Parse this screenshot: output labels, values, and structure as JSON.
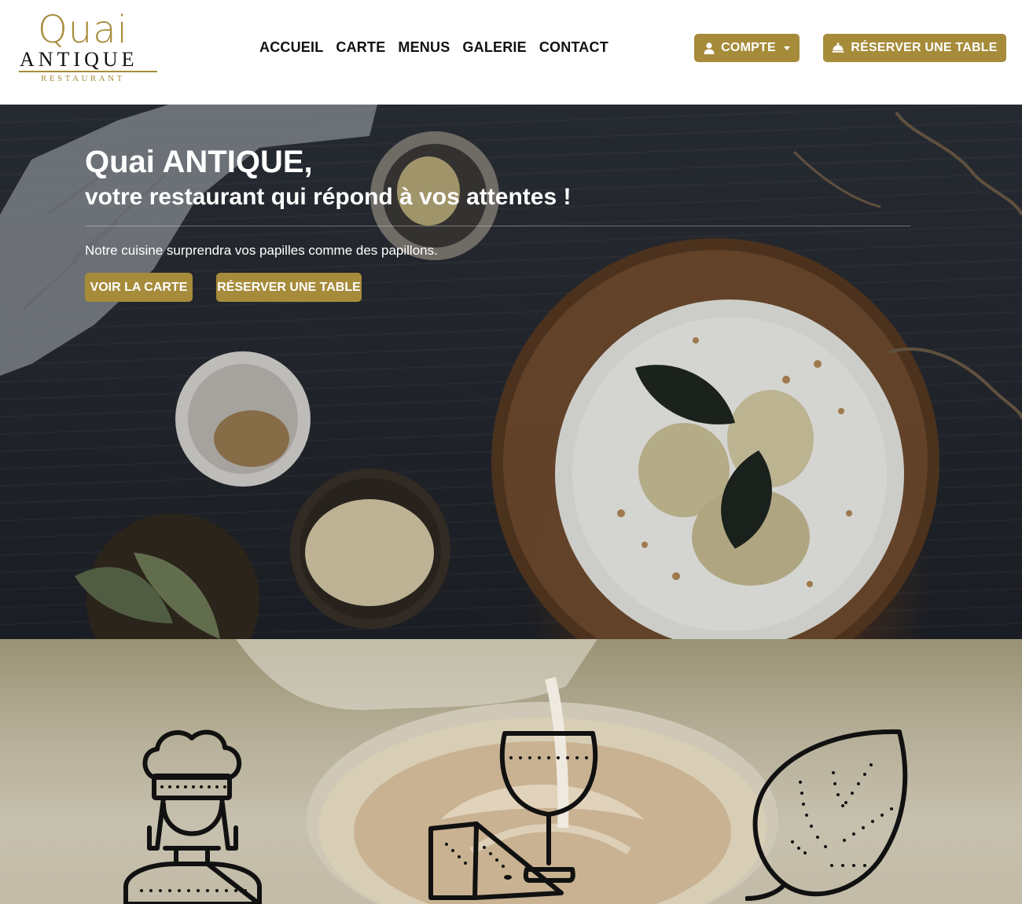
{
  "brand": {
    "name_top": "Quai",
    "name_main": "ANTIQUE",
    "name_sub": "RESTAURANT",
    "accent_color": "#a68b3a"
  },
  "nav": {
    "items": [
      {
        "label": "ACCUEIL"
      },
      {
        "label": "CARTE"
      },
      {
        "label": "MENUS"
      },
      {
        "label": "GALERIE"
      },
      {
        "label": "CONTACT"
      }
    ]
  },
  "header_actions": {
    "account_label": "COMPTE",
    "account_icon": "user-icon",
    "reserve_label": "RÉSERVER UNE TABLE",
    "reserve_icon": "cloche-icon"
  },
  "hero": {
    "title": "Quai ANTIQUE,",
    "subtitle": "votre restaurant qui répond à vos attentes !",
    "text": "Notre cuisine surprendra vos papilles comme des papillons.",
    "btn_menu": "VOIR LA CARTE",
    "btn_reserve": "RÉSERVER UNE TABLE"
  },
  "features": {
    "icons": [
      "chef-icon",
      "wine-cheese-icon",
      "leaf-icon"
    ]
  }
}
